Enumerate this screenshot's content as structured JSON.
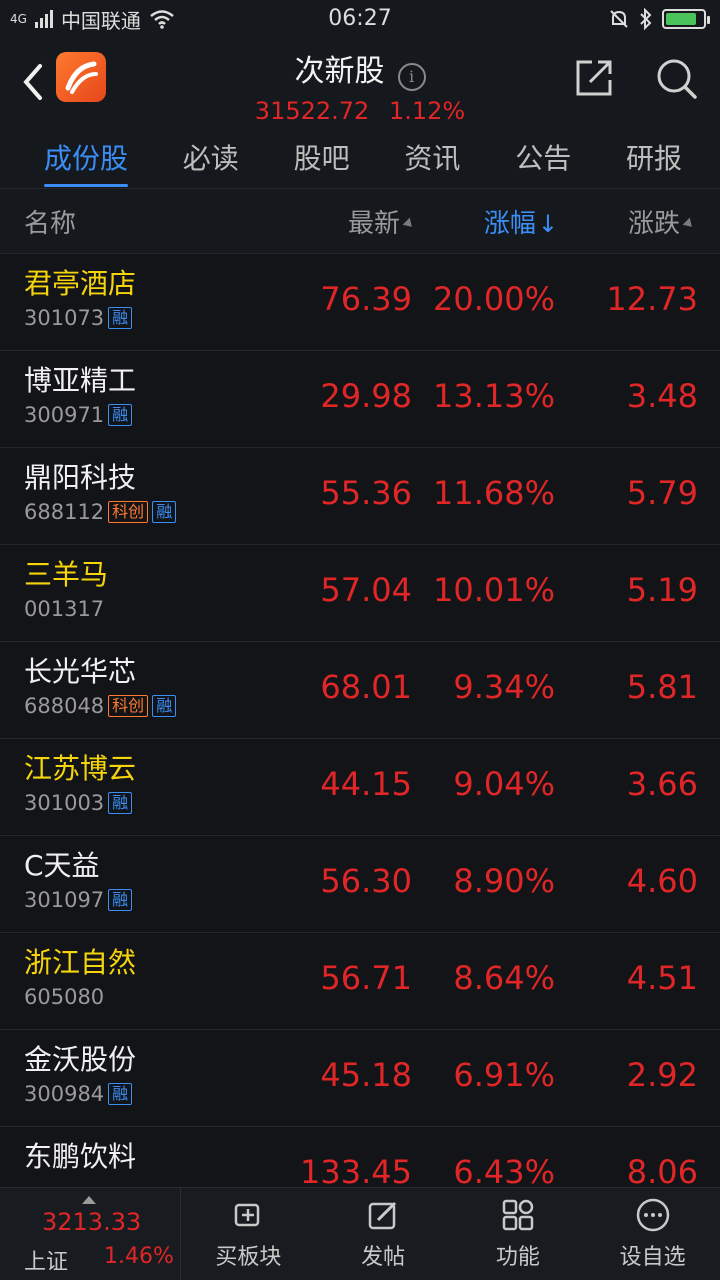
{
  "status": {
    "carrier": "中国联通",
    "network": "4G",
    "time": "06:27"
  },
  "header": {
    "title": "次新股",
    "index_value": "31522.72",
    "index_pct": "1.12%"
  },
  "tabs": [
    "成份股",
    "必读",
    "股吧",
    "资讯",
    "公告",
    "研报"
  ],
  "columns": {
    "name": "名称",
    "latest": "最新",
    "pct": "涨幅",
    "chg": "涨跌"
  },
  "stocks": [
    {
      "name": "君亭酒店",
      "code": "301073",
      "badges": [
        "融"
      ],
      "latest": "76.39",
      "pct": "20.00%",
      "chg": "12.73",
      "highlight_name": true
    },
    {
      "name": "博亚精工",
      "code": "300971",
      "badges": [
        "融"
      ],
      "latest": "29.98",
      "pct": "13.13%",
      "chg": "3.48",
      "highlight_name": false
    },
    {
      "name": "鼎阳科技",
      "code": "688112",
      "badges": [
        "科创",
        "融"
      ],
      "latest": "55.36",
      "pct": "11.68%",
      "chg": "5.79",
      "highlight_name": false
    },
    {
      "name": "三羊马",
      "code": "001317",
      "badges": [],
      "latest": "57.04",
      "pct": "10.01%",
      "chg": "5.19",
      "highlight_name": true
    },
    {
      "name": "长光华芯",
      "code": "688048",
      "badges": [
        "科创",
        "融"
      ],
      "latest": "68.01",
      "pct": "9.34%",
      "chg": "5.81",
      "highlight_name": false
    },
    {
      "name": "江苏博云",
      "code": "301003",
      "badges": [
        "融"
      ],
      "latest": "44.15",
      "pct": "9.04%",
      "chg": "3.66",
      "highlight_name": true
    },
    {
      "name": "C天益",
      "code": "301097",
      "badges": [
        "融"
      ],
      "latest": "56.30",
      "pct": "8.90%",
      "chg": "4.60",
      "highlight_name": false
    },
    {
      "name": "浙江自然",
      "code": "605080",
      "badges": [],
      "latest": "56.71",
      "pct": "8.64%",
      "chg": "4.51",
      "highlight_name": true
    },
    {
      "name": "金沃股份",
      "code": "300984",
      "badges": [
        "融"
      ],
      "latest": "45.18",
      "pct": "6.91%",
      "chg": "2.92",
      "highlight_name": false
    },
    {
      "name": "东鹏饮料",
      "code": "",
      "badges": [],
      "latest": "133.45",
      "pct": "6.43%",
      "chg": "8.06",
      "highlight_name": false
    }
  ],
  "bottom": {
    "index_value": "3213.33",
    "index_name": "上证",
    "index_pct": "1.46%",
    "nav": [
      "买板块",
      "发帖",
      "功能",
      "设自选"
    ]
  }
}
